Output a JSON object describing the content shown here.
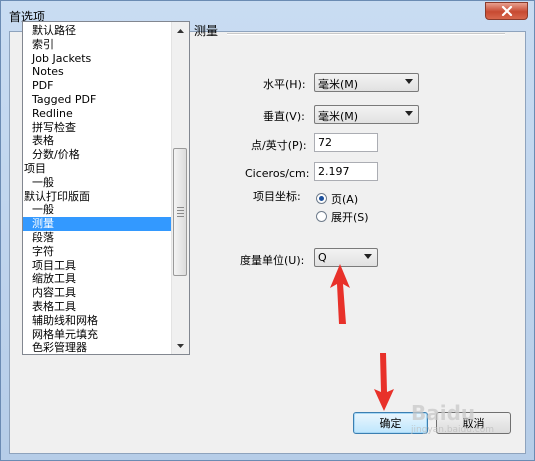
{
  "window": {
    "title": "首选项"
  },
  "sidebar": {
    "items": [
      {
        "label": "默认路径",
        "level": 1
      },
      {
        "label": "索引",
        "level": 1
      },
      {
        "label": "Job Jackets",
        "level": 1
      },
      {
        "label": "Notes",
        "level": 1
      },
      {
        "label": "PDF",
        "level": 1
      },
      {
        "label": "Tagged PDF",
        "level": 1
      },
      {
        "label": "Redline",
        "level": 1
      },
      {
        "label": "拼写检查",
        "level": 1
      },
      {
        "label": "表格",
        "level": 1
      },
      {
        "label": "分数/价格",
        "level": 1
      },
      {
        "label": "项目",
        "level": 0
      },
      {
        "label": "一般",
        "level": 1
      },
      {
        "label": "默认打印版面",
        "level": 0
      },
      {
        "label": "一般",
        "level": 1
      },
      {
        "label": "测量",
        "level": 1,
        "selected": true
      },
      {
        "label": "段落",
        "level": 1
      },
      {
        "label": "字符",
        "level": 1
      },
      {
        "label": "项目工具",
        "level": 1
      },
      {
        "label": "缩放工具",
        "level": 1
      },
      {
        "label": "内容工具",
        "level": 1
      },
      {
        "label": "表格工具",
        "level": 1
      },
      {
        "label": "辅助线和网格",
        "level": 1
      },
      {
        "label": "网格单元填充",
        "level": 1
      },
      {
        "label": "色彩管理器",
        "level": 1
      }
    ]
  },
  "panel": {
    "section_title": "测量",
    "horizontal": {
      "label": "水平(H):",
      "value": "毫米(M)"
    },
    "vertical": {
      "label": "垂直(V):",
      "value": "毫米(M)"
    },
    "points_per_inch": {
      "label": "点/英寸(P):",
      "value": "72"
    },
    "ciceros_per_cm": {
      "label": "Ciceros/cm:",
      "value": "2.197"
    },
    "item_coords": {
      "label": "项目坐标:",
      "option_page": "页(A)",
      "option_spread": "展开(S)",
      "selected": "page"
    },
    "measure_unit": {
      "label": "度量单位(U):",
      "value": "Q"
    }
  },
  "buttons": {
    "ok": "确定",
    "cancel": "取消"
  },
  "watermark": {
    "text": "Baidu",
    "sub": "jingyan.baidu.com"
  },
  "colors": {
    "accent": "#3399ff",
    "annotation_arrow": "#e8312a"
  }
}
